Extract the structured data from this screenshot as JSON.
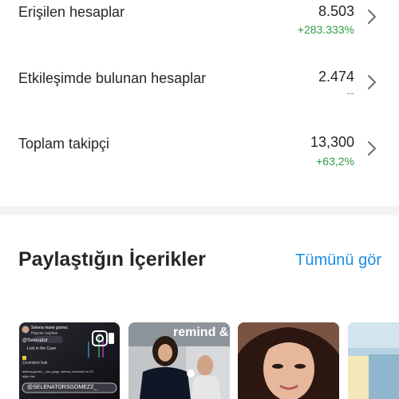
{
  "stats": [
    {
      "label": "Erişilen hesaplar",
      "value": "8.503",
      "change": "+283.333%",
      "change_type": "positive"
    },
    {
      "label": "Etkileşimde bulunan hesaplar",
      "value": "2.474",
      "change": "--",
      "change_type": "neutral"
    },
    {
      "label": "Toplam takipçi",
      "value": "13,300",
      "change": "+63,2%",
      "change_type": "positive"
    }
  ],
  "content_section": {
    "title": "Paylaştığın İçerikler",
    "see_all_label": "Tümünü gör"
  },
  "thumbnails": [
    {
      "header": "Selena marie gomez",
      "sub1": "Hayran sayfası",
      "tag": "@Selenator",
      "line1": "Lost in the Cave",
      "line2": "Çevirisine bak",
      "handle": "@SELENATORSGOMEZZ_",
      "caption": "selena.gomez__fan_page, selena_lovesss3 ve 22 diğer kişi",
      "icon": "video-icon"
    },
    {
      "sign": "remind &",
      "icon": "photo"
    },
    {
      "icon": "photo"
    },
    {
      "icon": "photo"
    }
  ],
  "colors": {
    "positive": "#2f9a45",
    "neutral": "#9a9a9a",
    "link": "#1a8fe3",
    "divider": "#f3f3f3"
  }
}
